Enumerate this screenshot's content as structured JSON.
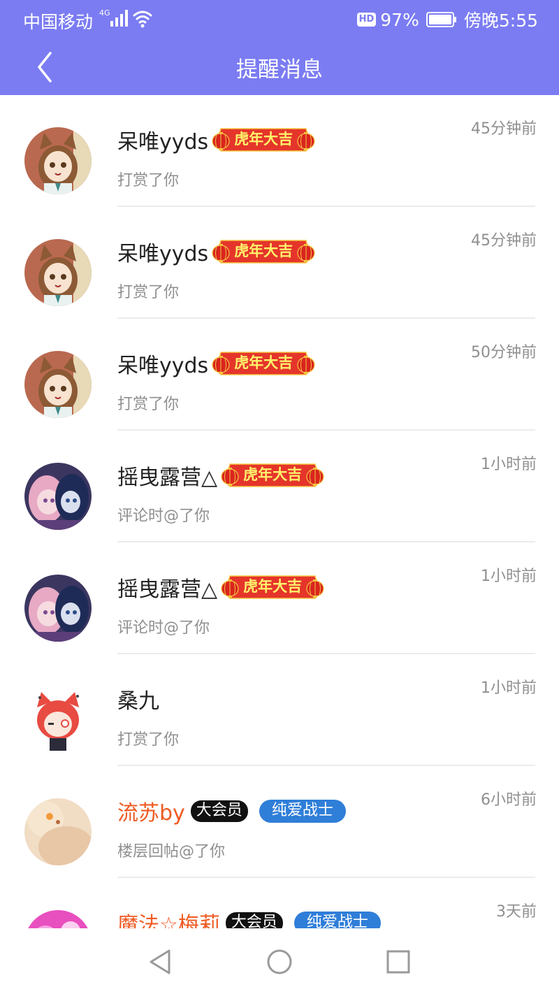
{
  "status_bar": {
    "carrier": "中国移动",
    "network": "4G",
    "hd": "HD",
    "battery": "97%",
    "time": "傍晚5:55"
  },
  "header": {
    "title": "提醒消息"
  },
  "banner_text": "虎年大吉",
  "items": [
    {
      "name": "呆唯yyds",
      "action": "打赏了你",
      "time": "45分钟前"
    },
    {
      "name": "呆唯yyds",
      "action": "打赏了你",
      "time": "45分钟前"
    },
    {
      "name": "呆唯yyds",
      "action": "打赏了你",
      "time": "50分钟前"
    },
    {
      "name": "摇曳露营△",
      "action": "评论时@了你",
      "time": "1小时前"
    },
    {
      "name": "摇曳露营△",
      "action": "评论时@了你",
      "time": "1小时前"
    },
    {
      "name": "桑九",
      "action": "打赏了你",
      "time": "1小时前"
    },
    {
      "name": "流苏by",
      "action": "楼层回帖@了你",
      "time": "6小时前",
      "badge_vip": "大会员",
      "badge_title": "纯爱战士"
    },
    {
      "name": "魔法☆梅莉",
      "action": "",
      "time": "3天前",
      "badge_vip": "大会员",
      "badge_title": "纯爱战士"
    }
  ],
  "colors": {
    "header": "#7b7cf2",
    "vip_name": "#ef5a22",
    "badge_blue": "#2f7ed8",
    "banner_red": "#e5352b",
    "banner_text": "#fff36b"
  }
}
